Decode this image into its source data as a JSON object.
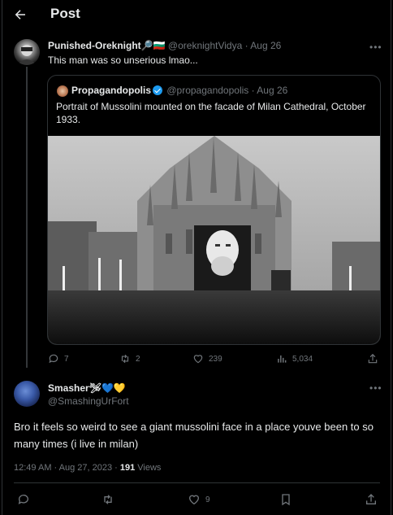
{
  "header": {
    "title": "Post"
  },
  "tweet": {
    "author_name": "Punished-Oreknight",
    "author_emoji": "🔎🇧🇬",
    "author_handle": "@oreknightVidya",
    "date": "Aug 26",
    "text": "This man was so unserious lmao..."
  },
  "quote": {
    "author_name": "Propagandopolis",
    "author_handle": "@propagandopolis",
    "date": "Aug 26",
    "text": "Portrait of Mussolini mounted on the facade of Milan Cathedral, October 1933."
  },
  "tweet_actions": {
    "replies": "7",
    "retweets": "2",
    "likes": "239",
    "views": "5,034"
  },
  "reply": {
    "author_name": "Smasher",
    "author_emoji": "🛩💙💛",
    "author_handle": "@SmashingUrFort",
    "text": "Bro it feels so weird to see a giant mussolini face in a place youve been to so many times (i live in milan)",
    "timestamp": "12:49 AM · Aug 27, 2023",
    "separator": " · ",
    "views_count": "191",
    "views_label": " Views"
  },
  "reply_actions": {
    "likes": "9"
  }
}
